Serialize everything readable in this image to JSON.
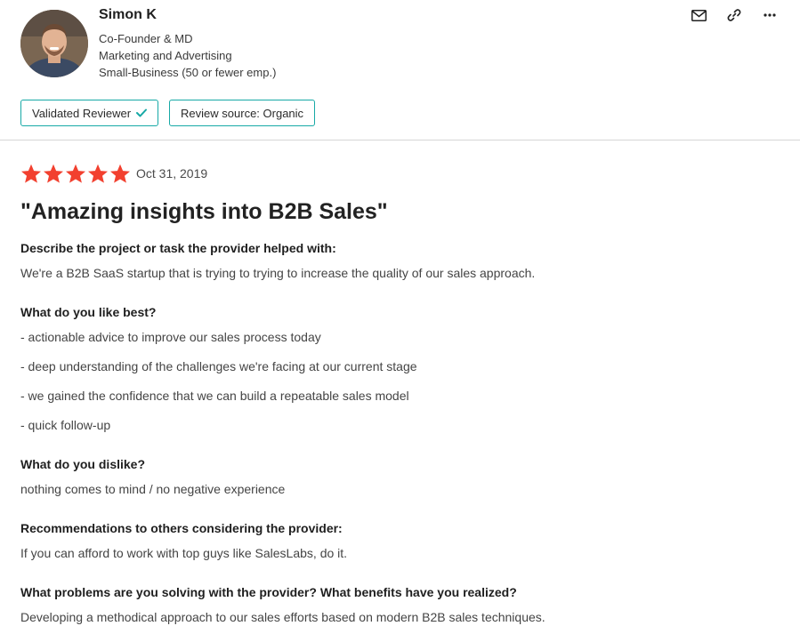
{
  "reviewer": {
    "name": "Simon K",
    "role": "Co-Founder & MD",
    "industry": "Marketing and Advertising",
    "company_size": "Small-Business (50 or fewer emp.)"
  },
  "actions": {
    "email_icon": "envelope-icon",
    "link_icon": "link-icon",
    "more_icon": "more-horizontal-icon"
  },
  "badges": {
    "validated": "Validated Reviewer",
    "source": "Review source: Organic"
  },
  "review": {
    "rating": 5,
    "rating_max": 5,
    "date": "Oct 31, 2019",
    "title": "\"Amazing insights into B2B Sales\"",
    "sections": [
      {
        "question": "Describe the project or task the provider helped with:",
        "answers": [
          "We're a B2B SaaS startup that is trying to trying to increase the quality of our sales approach."
        ]
      },
      {
        "question": "What do you like best?",
        "answers": [
          "- actionable advice to improve our sales process today",
          "- deep understanding of the challenges we're facing at our current stage",
          "- we gained the confidence that we can build a repeatable sales model",
          "- quick follow-up"
        ]
      },
      {
        "question": "What do you dislike?",
        "answers": [
          "nothing comes to mind / no negative experience"
        ]
      },
      {
        "question": "Recommendations to others considering the provider:",
        "answers": [
          "If you can afford to work with top guys like SalesLabs, do it."
        ]
      },
      {
        "question": "What problems are you solving with the provider? What benefits have you realized?",
        "answers": [
          "Developing a methodical approach to our sales efforts based on modern B2B sales techniques."
        ]
      }
    ]
  },
  "colors": {
    "star": "#f2402f",
    "accent": "#17a9a6",
    "divider": "#d6d6d6"
  }
}
